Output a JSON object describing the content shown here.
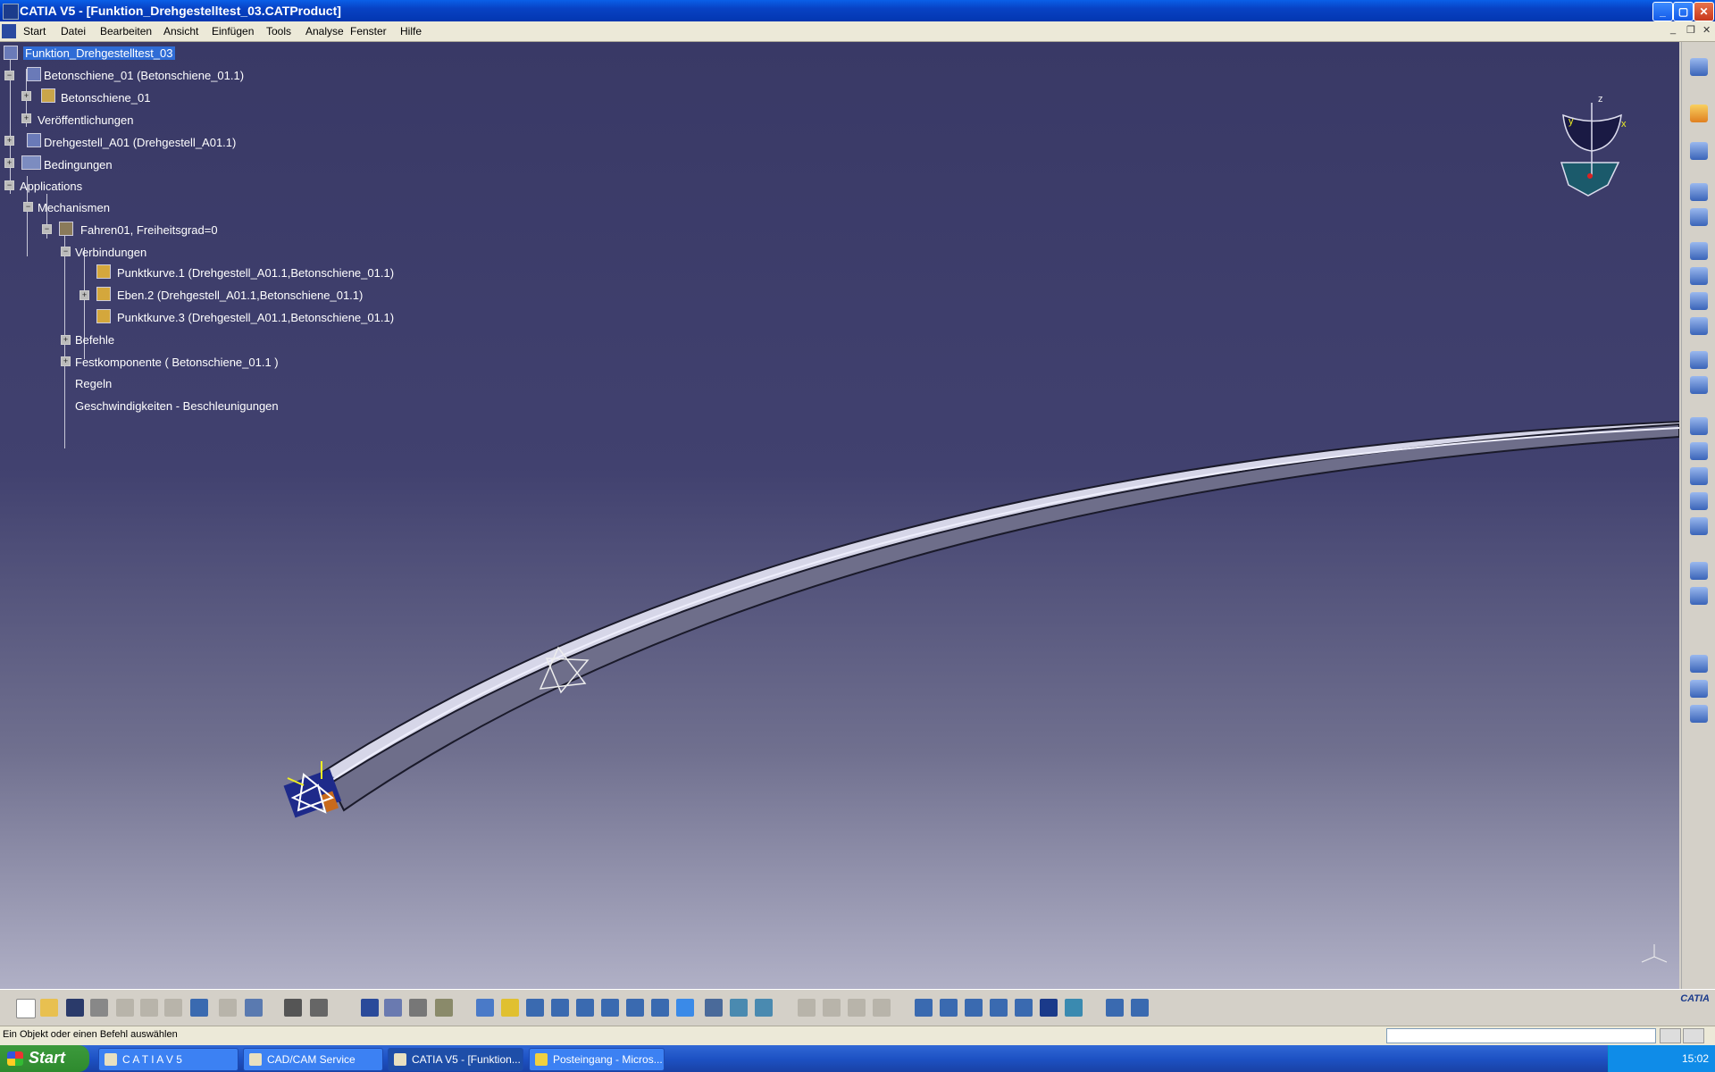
{
  "window": {
    "title": "CATIA V5 - [Funktion_Drehgestelltest_03.CATProduct]",
    "min": "_",
    "max": "▢",
    "close": "✕"
  },
  "menu": {
    "items": [
      "Start",
      "Datei",
      "Bearbeiten",
      "Ansicht",
      "Einfügen",
      "Tools",
      "Analyse",
      "Fenster",
      "Hilfe"
    ],
    "mdi_min": "_",
    "mdi_restore": "❐",
    "mdi_close": "✕"
  },
  "tree": {
    "root": "Funktion_Drehgestelltest_03",
    "n1": "Betonschiene_01 (Betonschiene_01.1)",
    "n2": "Betonschiene_01",
    "n3": "Veröffentlichungen",
    "n4": "Drehgestell_A01 (Drehgestell_A01.1)",
    "n5": "Bedingungen",
    "n6": "Applications",
    "n7": "Mechanismen",
    "n8": "Fahren01, Freiheitsgrad=0",
    "n9": "Verbindungen",
    "n10": "Punktkurve.1 (Drehgestell_A01.1,Betonschiene_01.1)",
    "n11": "Eben.2 (Drehgestell_A01.1,Betonschiene_01.1)",
    "n12": "Punktkurve.3 (Drehgestell_A01.1,Betonschiene_01.1)",
    "n13": "Befehle",
    "n14": "Festkomponente ( Betonschiene_01.1 )",
    "n15": "Regeln",
    "n16": "Geschwindigkeiten - Beschleunigungen"
  },
  "compass": {
    "z": "z",
    "x": "x",
    "y": "y"
  },
  "status": {
    "message": "Ein Objekt oder einen Befehl auswählen"
  },
  "toolbar": {
    "logo": "CATIA"
  },
  "taskbar": {
    "start": "Start",
    "tasks": [
      "C A T I A  V 5",
      "CAD/CAM Service",
      "CATIA V5 - [Funktion...",
      "Posteingang - Micros..."
    ],
    "clock": "15:02"
  },
  "icons": {
    "tree_product": "product-icon",
    "tree_part": "part-icon",
    "tree_joint": "joint-icon",
    "compass": "compass-icon"
  }
}
